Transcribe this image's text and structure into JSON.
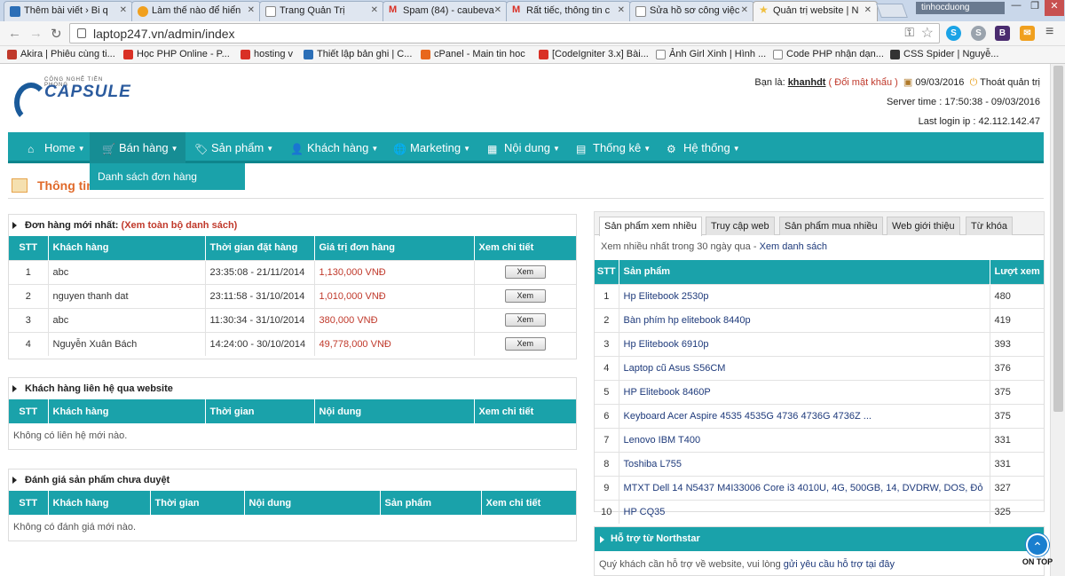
{
  "browser": {
    "tabs": [
      {
        "title": "Thêm bài viết › Bi q",
        "color": "#2c6fb7"
      },
      {
        "title": "Làm thế nào để hiển",
        "color": "#f0a01e"
      },
      {
        "title": "Trang Quản Trị",
        "color": "#ffffff"
      },
      {
        "title": "Spam (84) - caubeva",
        "color": "#d93025"
      },
      {
        "title": "Rất tiếc, thông tin c",
        "color": "#d93025"
      },
      {
        "title": "Sửa hồ sơ công việc",
        "color": "#ffffff"
      },
      {
        "title": "Quản trị website | N",
        "color": "#f0c040"
      }
    ],
    "profile": "tinhocduong",
    "url": "laptop247.vn/admin/index",
    "bookmarks": [
      {
        "label": "Akira | Phiêu cùng ti...",
        "color": "#c0392b"
      },
      {
        "label": "Học PHP Online - P...",
        "color": "#d93025"
      },
      {
        "label": "hosting v",
        "color": "#d93025"
      },
      {
        "label": "Thiết lập bản ghi | C...",
        "color": "#2c6fb7"
      },
      {
        "label": "cPanel - Main tin hoc",
        "color": "#e8671c"
      },
      {
        "label": "[CodeIgniter 3.x] Bài...",
        "color": "#d93025"
      },
      {
        "label": "Ảnh Girl Xinh | Hình ...",
        "color": "#888888"
      },
      {
        "label": "Code PHP nhận dạn...",
        "color": "#888888"
      },
      {
        "label": "CSS Spider | Nguyễ...",
        "color": "#333333"
      }
    ]
  },
  "header": {
    "brand": "CAPSULE",
    "tagline": "CÔNG NGHỆ TIỀN PHONG",
    "greeting": "Bạn là:",
    "username": "khanhdt",
    "change_pw": "( Đổi mật khẩu )",
    "date": "09/03/2016",
    "logout": "Thoát quản trị",
    "server_time": "Server time : 17:50:38 - 09/03/2016",
    "last_login": "Last login ip : 42.112.142.47"
  },
  "nav": [
    {
      "label": "Home",
      "icon": "home-icon"
    },
    {
      "label": "Bán hàng",
      "icon": "cart-icon"
    },
    {
      "label": "Sản phẩm",
      "icon": "tag-icon"
    },
    {
      "label": "Khách hàng",
      "icon": "user-icon"
    },
    {
      "label": "Marketing",
      "icon": "globe-icon"
    },
    {
      "label": "Nội dung",
      "icon": "content-icon"
    },
    {
      "label": "Thống kê",
      "icon": "chart-icon"
    },
    {
      "label": "Hệ thống",
      "icon": "gears-icon"
    }
  ],
  "dropdown_item": "Danh sách đơn hàng",
  "page_title": "Thông tin",
  "orders": {
    "title": "Đơn hàng mới nhất:",
    "link": "(Xem toàn bộ danh sách)",
    "columns": [
      "STT",
      "Khách hàng",
      "Thời gian đặt hàng",
      "Giá trị đơn hàng",
      "Xem chi tiết"
    ],
    "rows": [
      {
        "stt": "1",
        "customer": "abc",
        "time": "23:35:08 - 21/11/2014",
        "value": "1,130,000 VNĐ"
      },
      {
        "stt": "2",
        "customer": "nguyen thanh dat",
        "time": "23:11:58 - 31/10/2014",
        "value": "1,010,000 VNĐ"
      },
      {
        "stt": "3",
        "customer": "abc",
        "time": "11:30:34 - 31/10/2014",
        "value": "380,000 VNĐ"
      },
      {
        "stt": "4",
        "customer": "Nguyễn Xuân Bách",
        "time": "14:24:00 - 30/10/2014",
        "value": "49,778,000 VNĐ"
      }
    ],
    "view_label": "Xem"
  },
  "contacts": {
    "title": "Khách hàng liên hệ qua website",
    "columns": [
      "STT",
      "Khách hàng",
      "Thời gian",
      "Nội dung",
      "Xem chi tiết"
    ],
    "empty": "Không có liên hệ mới nào."
  },
  "reviews": {
    "title": "Đánh giá sản phẩm chưa duyệt",
    "columns": [
      "STT",
      "Khách hàng",
      "Thời gian",
      "Nội dung",
      "Sản phẩm",
      "Xem chi tiết"
    ],
    "empty": "Không có đánh giá mới nào."
  },
  "stats": {
    "tabs": [
      "Sản phẩm xem nhiều",
      "Truy cập web",
      "Sản phẩm mua nhiều",
      "Web giới thiệu",
      "Từ khóa"
    ],
    "subtitle": "Xem nhiều nhất trong 30 ngày qua -",
    "sublink": "Xem danh sách",
    "columns": [
      "STT",
      "Sản phẩm",
      "Lượt xem"
    ],
    "rows": [
      {
        "stt": "1",
        "name": "Hp Elitebook 2530p",
        "views": "480"
      },
      {
        "stt": "2",
        "name": "Bàn phím hp elitebook 8440p",
        "views": "419"
      },
      {
        "stt": "3",
        "name": "Hp Elitebook 6910p",
        "views": "393"
      },
      {
        "stt": "4",
        "name": "Laptop cũ Asus S56CM",
        "views": "376"
      },
      {
        "stt": "5",
        "name": "HP Elitebook 8460P",
        "views": "375"
      },
      {
        "stt": "6",
        "name": "Keyboard Acer Aspire 4535 4535G 4736 4736G 4736Z ...",
        "views": "375"
      },
      {
        "stt": "7",
        "name": "Lenovo IBM T400",
        "views": "331"
      },
      {
        "stt": "8",
        "name": "Toshiba L755",
        "views": "331"
      },
      {
        "stt": "9",
        "name": "MTXT Dell 14 N5437 M4I33006 Core i3 4010U, 4G, 500GB, 14, DVDRW, DOS, Đỏ",
        "views": "327"
      },
      {
        "stt": "10",
        "name": "HP CQ35",
        "views": "325"
      }
    ]
  },
  "support": {
    "title": "Hỗ trợ từ Northstar",
    "text": "Quý khách cần hỗ trợ về website, vui lòng",
    "link": "gửi yêu cầu hỗ trợ tại đây"
  },
  "ontop": "ON TOP",
  "theme": {
    "accent": "#1aa2aa",
    "danger": "#c0392b",
    "link": "#1e3a7b"
  }
}
